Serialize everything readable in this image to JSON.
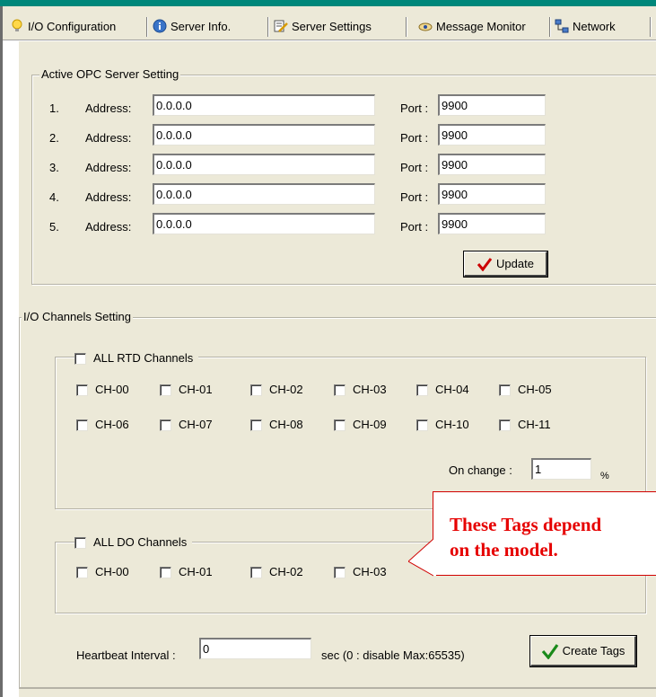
{
  "tabs": [
    {
      "label": "I/O Configuration",
      "icon": "lightbulb-icon"
    },
    {
      "label": "Server Info.",
      "icon": "info-icon"
    },
    {
      "label": "Server Settings",
      "icon": "settings-pencil-icon"
    },
    {
      "label": "Message Monitor",
      "icon": "monitor-eye-icon"
    },
    {
      "label": "Network",
      "icon": "network-icon"
    }
  ],
  "opc": {
    "title": "Active OPC Server Setting",
    "address_label": "Address:",
    "port_label": "Port :",
    "rows": [
      {
        "num": "1.",
        "address": "0.0.0.0",
        "port": "9900"
      },
      {
        "num": "2.",
        "address": "0.0.0.0",
        "port": "9900"
      },
      {
        "num": "3.",
        "address": "0.0.0.0",
        "port": "9900"
      },
      {
        "num": "4.",
        "address": "0.0.0.0",
        "port": "9900"
      },
      {
        "num": "5.",
        "address": "0.0.0.0",
        "port": "9900"
      }
    ],
    "update_label": "Update"
  },
  "io": {
    "title": "I/O Channels Setting",
    "rtd": {
      "all_label": "ALL RTD Channels",
      "row1": [
        "CH-00",
        "CH-01",
        "CH-02",
        "CH-03",
        "CH-04",
        "CH-05"
      ],
      "row2": [
        "CH-06",
        "CH-07",
        "CH-08",
        "CH-09",
        "CH-10",
        "CH-11"
      ],
      "on_change_label": "On change :",
      "on_change_value": "1",
      "on_change_unit": "%"
    },
    "do": {
      "all_label": "ALL DO Channels",
      "channels": [
        "CH-00",
        "CH-01",
        "CH-02",
        "CH-03"
      ]
    }
  },
  "heartbeat": {
    "label": "Heartbeat Interval :",
    "value": "0",
    "hint": "sec  (0 : disable  Max:65535)"
  },
  "create_tags_label": "Create Tags",
  "callout": {
    "line1": "These Tags depend",
    "line2": "on the model."
  },
  "colors": {
    "accent_bar": "#00877a",
    "panel_bg": "#ece9d8",
    "callout_text": "#e60000",
    "check_mark": "#cc0000",
    "check_mark_green": "#1a8a1a"
  }
}
